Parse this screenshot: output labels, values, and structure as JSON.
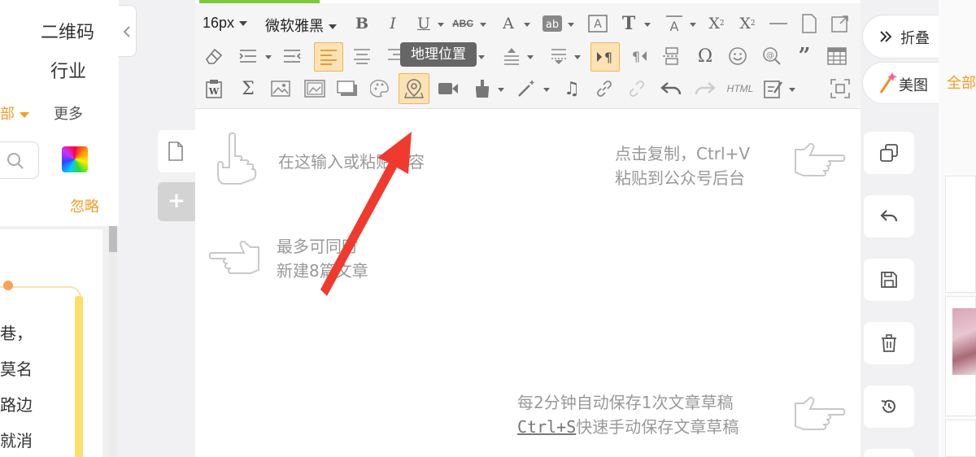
{
  "left_panel": {
    "qr_label": "二维码",
    "industry_label": "行业",
    "all_label": "部",
    "more_label": "更多",
    "ignore_label": "忽略",
    "lines": [
      "巷，",
      "莫名",
      "路边",
      "就消"
    ]
  },
  "toolbar": {
    "font_size": "16px",
    "font_family": "微软雅黑",
    "tooltip": "地理位置",
    "html_label": "HTML"
  },
  "editor": {
    "hint_input": "在这输入或粘贴内容",
    "hint_copy_line1": "点击复制，Ctrl+V",
    "hint_copy_line2": "粘贴到公众号后台",
    "hint_multi_line1": "最多可同时",
    "hint_multi_line2": "新建8篇文章",
    "hint_save_line1": "每2分钟自动保存1次文章草稿",
    "hint_save_ctrl": "Ctrl+S",
    "hint_save_line2_rest": "快速手动保存文章草稿"
  },
  "right_panel": {
    "collapse_label": "折叠",
    "beauty_label": "美图",
    "all_label": "全部"
  },
  "colors": {
    "accent_orange": "#f29c2b",
    "progress_green": "#7ec83d",
    "arrow_red": "#f03a2e"
  }
}
